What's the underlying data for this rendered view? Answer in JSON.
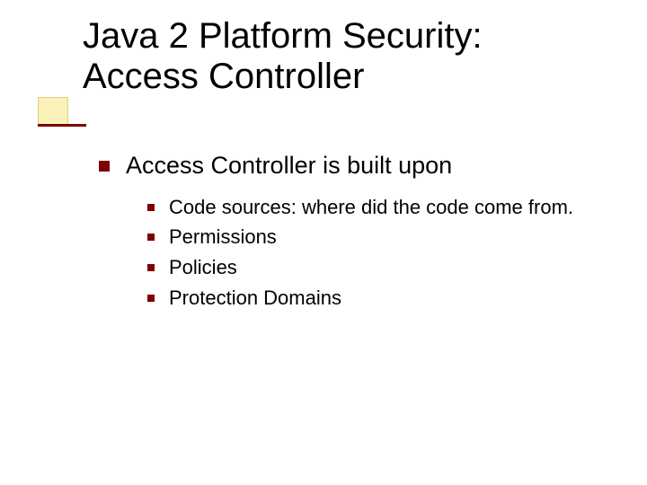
{
  "title": "Java 2 Platform Security: Access Controller",
  "bullets": {
    "lvl1": "Access Controller is built upon",
    "lvl2": [
      "Code sources: where did the code come from.",
      "Permissions",
      "Policies",
      "Protection Domains"
    ]
  }
}
